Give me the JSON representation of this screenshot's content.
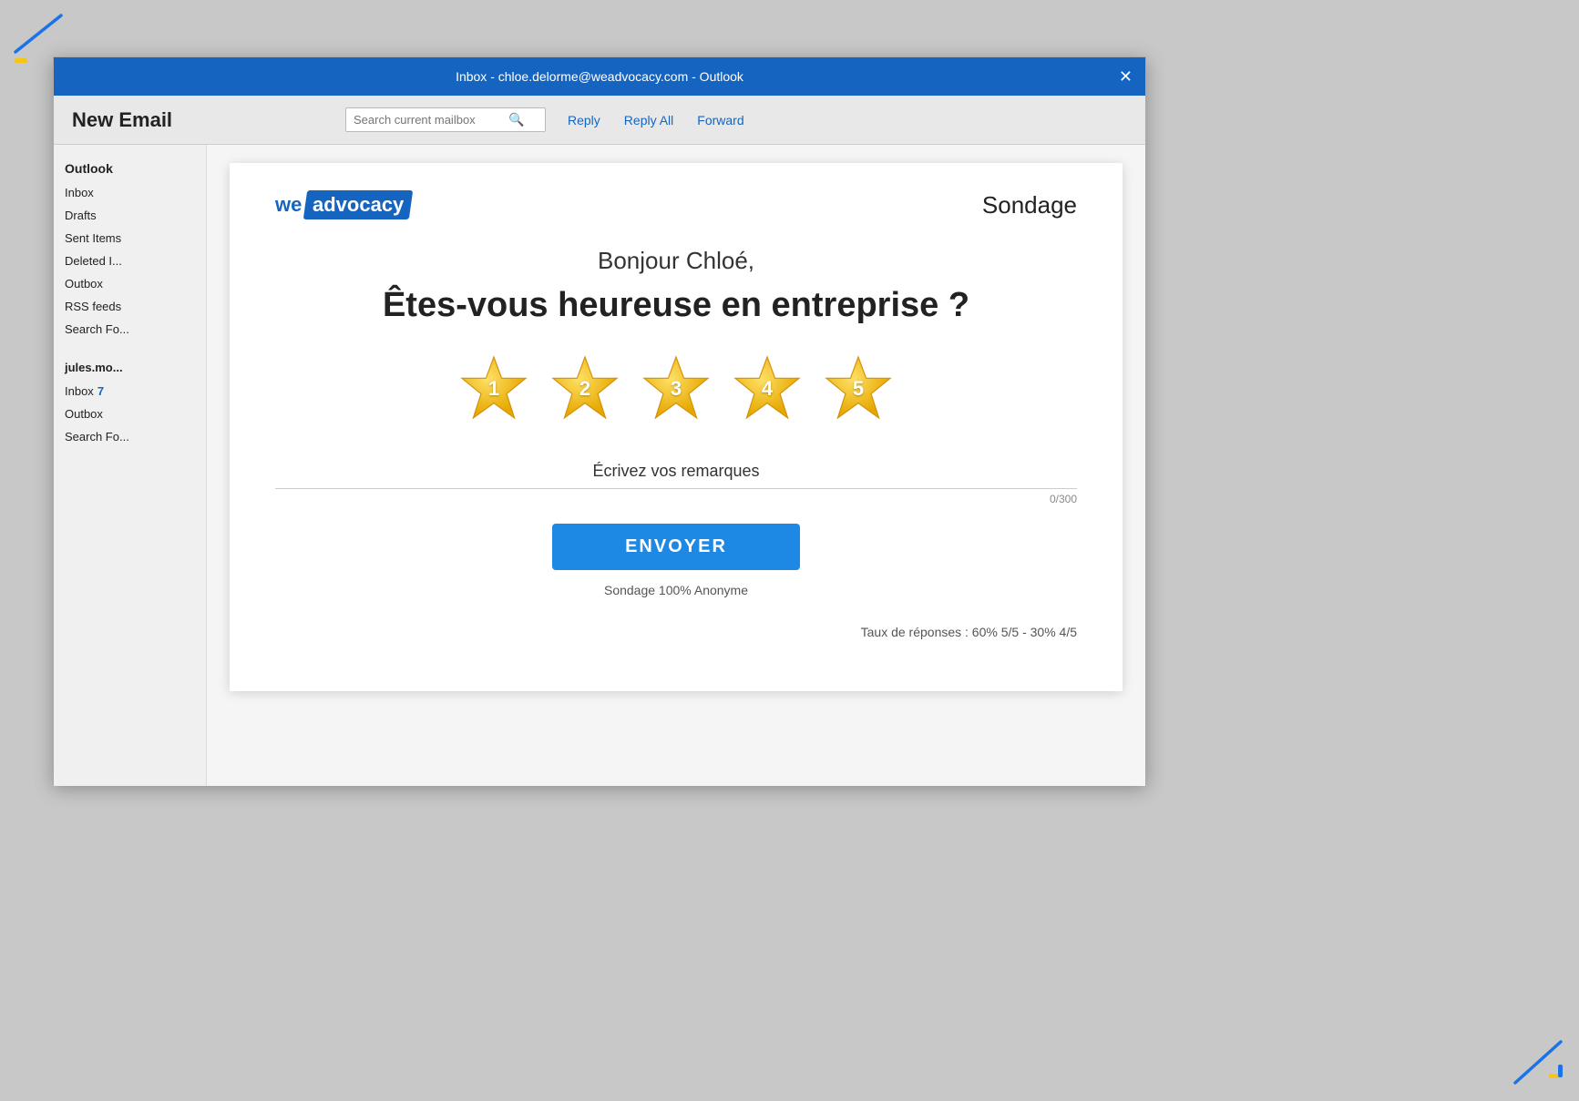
{
  "decorative": {
    "colors": {
      "blue_accent": "#1565c0",
      "yellow_accent": "#f5c518",
      "star_gold": "#f5a623"
    }
  },
  "window": {
    "title": "Inbox - chloe.delorme@weadvocacy.com - Outlook",
    "close_label": "✕"
  },
  "toolbar": {
    "new_email_label": "New Email",
    "search_placeholder": "Search current mailbox",
    "reply_label": "Reply",
    "reply_all_label": "Reply All",
    "forward_label": "Forward"
  },
  "sidebar": {
    "section1_title": "Outlook",
    "items1": [
      {
        "label": "Inbox",
        "badge": ""
      },
      {
        "label": "Drafts",
        "badge": ""
      },
      {
        "label": "Sent Items",
        "badge": ""
      },
      {
        "label": "Deleted I...",
        "badge": ""
      },
      {
        "label": "Outbox",
        "badge": ""
      },
      {
        "label": "RSS feeds",
        "badge": ""
      },
      {
        "label": "Search Fo...",
        "badge": ""
      }
    ],
    "section2_title": "jules.mo...",
    "items2": [
      {
        "label": "Inbox",
        "badge": "7"
      },
      {
        "label": "Outbox",
        "badge": ""
      },
      {
        "label": "Search Fo...",
        "badge": ""
      }
    ]
  },
  "email": {
    "brand_we": "we",
    "brand_advocacy": "advocacy",
    "card_title": "Sondage",
    "greeting": "Bonjour Chloé,",
    "question": "Êtes-vous heureuse en entreprise ?",
    "stars": [
      {
        "number": "1"
      },
      {
        "number": "2"
      },
      {
        "number": "3"
      },
      {
        "number": "4"
      },
      {
        "number": "5"
      }
    ],
    "remarks_label": "Écrivez vos remarques",
    "remarks_counter": "0/300",
    "submit_label": "ENVOYER",
    "anon_note": "Sondage 100% Anonyme",
    "response_rate": "Taux de réponses : 60% 5/5 - 30% 4/5"
  }
}
